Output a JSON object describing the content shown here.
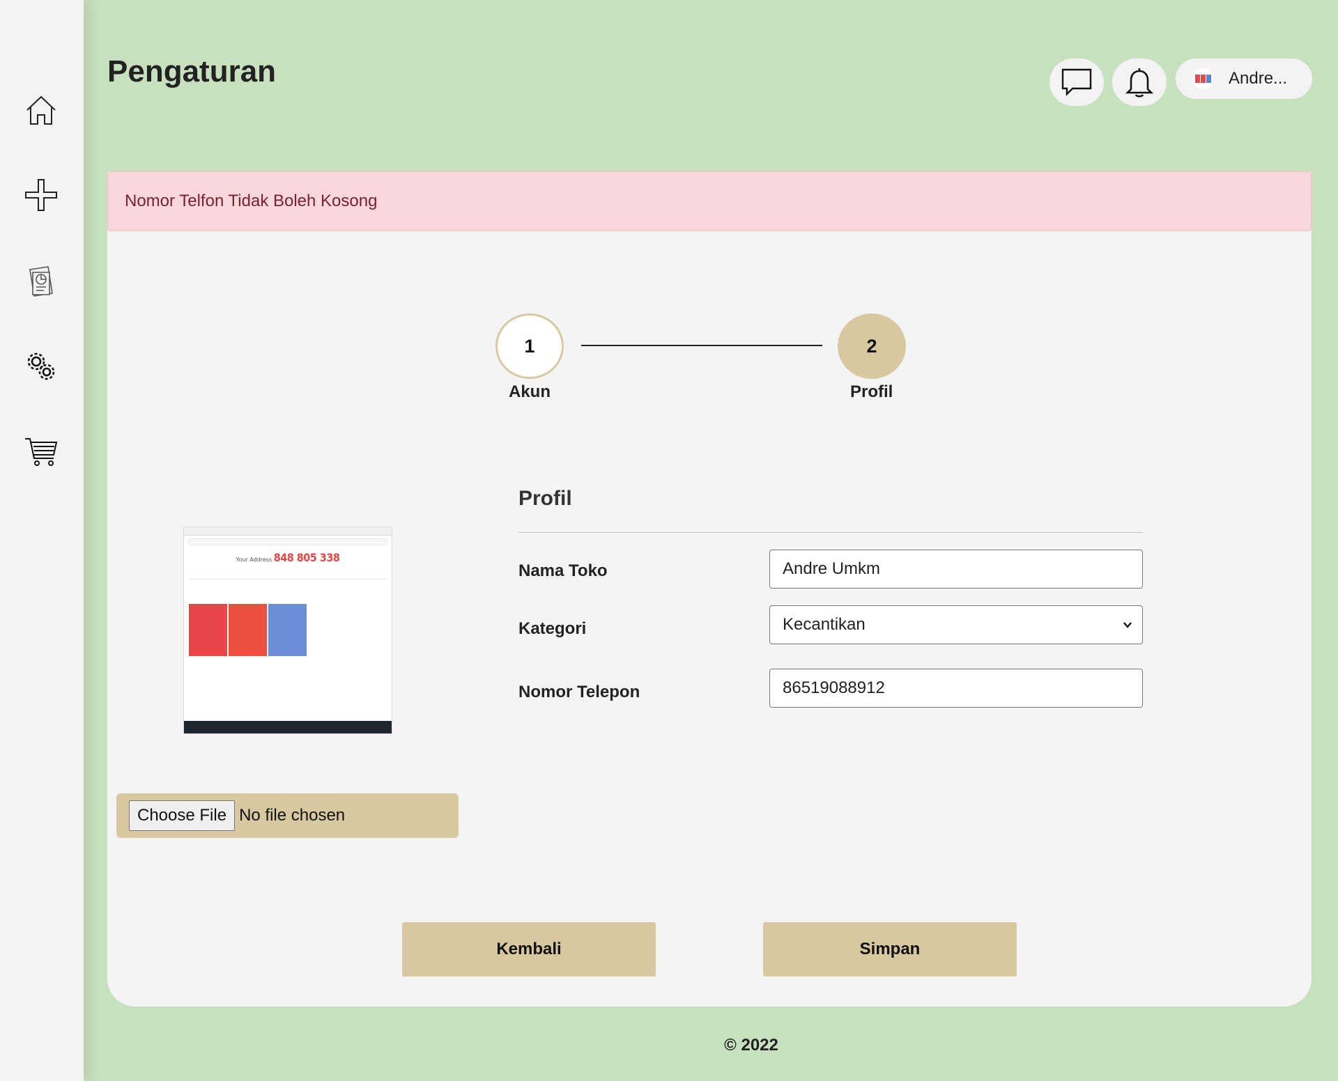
{
  "header": {
    "title": "Pengaturan",
    "user_name": "Andre..."
  },
  "sidebar": {
    "items": [
      {
        "name": "home",
        "icon": "home-icon"
      },
      {
        "name": "add",
        "icon": "plus-icon"
      },
      {
        "name": "reports",
        "icon": "report-icon"
      },
      {
        "name": "settings",
        "icon": "gears-icon"
      },
      {
        "name": "cart",
        "icon": "cart-icon"
      }
    ]
  },
  "alert": {
    "message": "Nomor Telfon Tidak Boleh Kosong",
    "color": "#f8d7dc"
  },
  "stepper": {
    "steps": [
      {
        "number": "1",
        "label": "Akun"
      },
      {
        "number": "2",
        "label": "Profil"
      }
    ],
    "active_step": 2
  },
  "preview": {
    "address_label": "Your Address",
    "address_number": "848 805 338"
  },
  "file_input": {
    "button_label": "Choose File",
    "status": "No file chosen"
  },
  "form": {
    "title": "Profil",
    "fields": [
      {
        "label": "Nama Toko",
        "value": "Andre Umkm"
      },
      {
        "label": "Kategori",
        "value": "Kecantikan"
      },
      {
        "label": "Nomor Telepon",
        "value": "86519088912"
      }
    ]
  },
  "actions": {
    "back_label": "Kembali",
    "save_label": "Simpan"
  },
  "footer": {
    "text": "© 2022"
  },
  "colors": {
    "background": "#c7e0bd",
    "accent": "#d7c8a0",
    "card": "#f4f4f4"
  }
}
